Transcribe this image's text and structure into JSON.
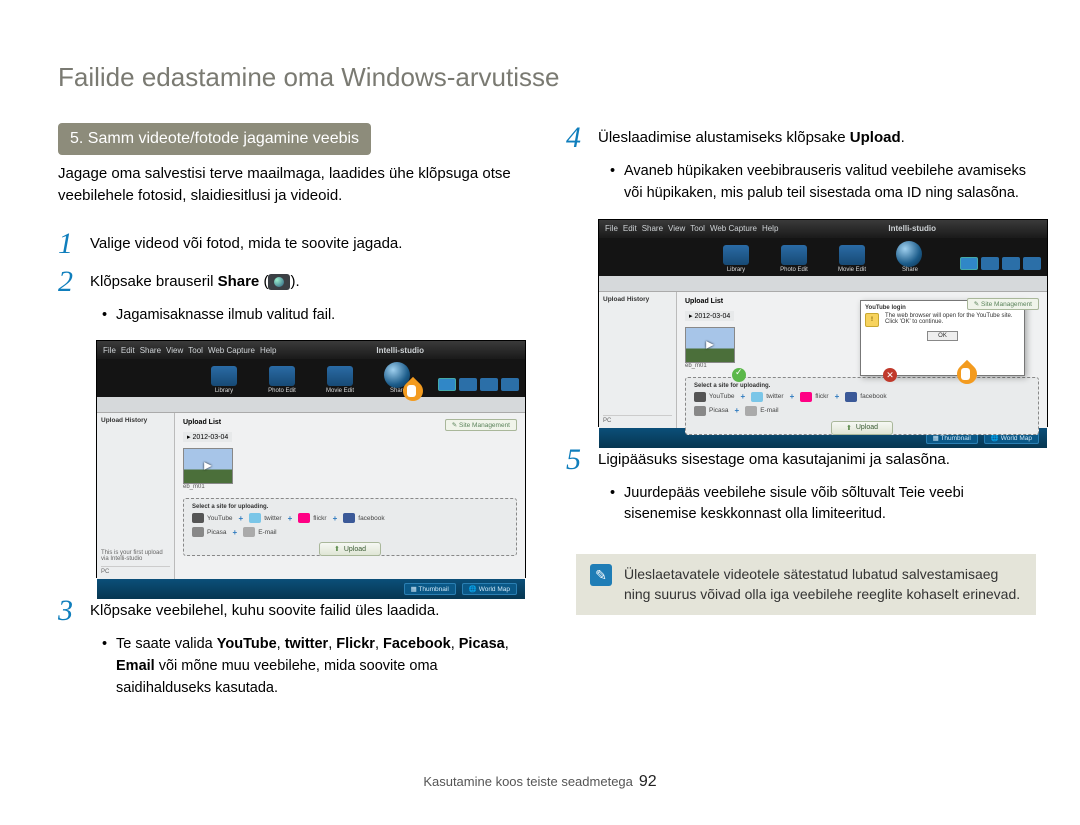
{
  "page_title": "Failide edastamine oma Windows-arvutisse",
  "step_header": "5. Samm videote/fotode jagamine veebis",
  "intro": "Jagage oma salvestisi terve maailmaga, laadides ühe klõpsuga otse veebilehele fotosid, slaidiesitlusi ja videoid.",
  "steps": {
    "s1": {
      "num": "1",
      "text": "Valige videod või fotod, mida te soovite jagada."
    },
    "s2": {
      "num": "2",
      "text_pre": "Klõpsake brauseril ",
      "bold": "Share",
      "text_post": " (",
      "close": ").",
      "bullet": "Jagamisaknasse ilmub valitud fail."
    },
    "s3": {
      "num": "3",
      "text": "Klõpsake veebilehel, kuhu soovite failid üles laadida.",
      "bullet_pre": "Te saate valida ",
      "b_yt": "YouTube",
      "b_tw": "twitter",
      "b_fl": "Flickr",
      "b_fb": "Facebook",
      "b_pc": "Picasa",
      "b_em": "Email",
      "bullet_post": " või mõne muu veebilehe, mida soovite oma saidihalduseks kasutada."
    },
    "s4": {
      "num": "4",
      "text_pre": "Üleslaadimise alustamiseks klõpsake ",
      "bold": "Upload",
      "text_post": ".",
      "bullet": "Avaneb hüpikaken veebibrauseris valitud veebilehe avamiseks või hüpikaken, mis palub teil sisestada oma ID ning salasõna."
    },
    "s5": {
      "num": "5",
      "text": "Ligipääsuks sisestage oma kasutajanimi ja salasõna.",
      "bullet": "Juurdepääs veebilehe sisule võib sõltuvalt Teie veebi sisenemise keskkonnast olla limiteeritud."
    }
  },
  "note": "Üleslaetavatele videotele sätestatud lubatud salvestamisaeg ning suurus võivad olla iga veebilehe reeglite kohaselt erinevad.",
  "footer": {
    "section": "Kasutamine koos teiste seadmetega",
    "page": "92"
  },
  "shot": {
    "menu": {
      "file": "File",
      "edit": "Edit",
      "share": "Share",
      "view": "View",
      "tool": "Tool",
      "capture": "Web Capture",
      "help": "Help"
    },
    "brand": "Intelli-studio",
    "tb": {
      "library": "Library",
      "photo": "Photo Edit",
      "movie": "Movie Edit",
      "share": "Share"
    },
    "panel": {
      "history": "Upload History",
      "list": "Upload List",
      "date": "2012-03-04",
      "file": "eb_m01",
      "prev": "PC",
      "select": "Select a site for uploading.",
      "upload": "Upload",
      "sm": "Site Management"
    },
    "svc": {
      "yt": "YouTube",
      "tw": "twitter",
      "fl": "flickr",
      "fb": "facebook",
      "em": "E-mail"
    },
    "ftr": {
      "thumb": "Thumbnail",
      "map": "World Map"
    },
    "modal": {
      "title": "YouTube login",
      "text": "The web browser will open for the YouTube site. Click 'OK' to continue.",
      "ok": "OK"
    }
  }
}
